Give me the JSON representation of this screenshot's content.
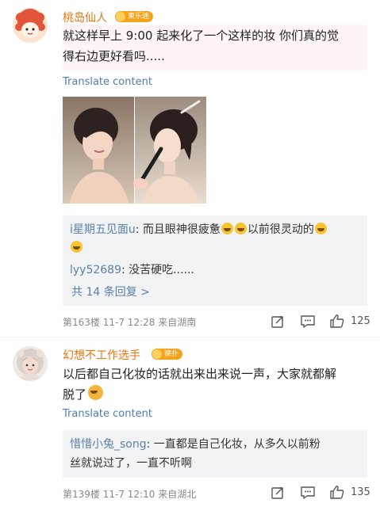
{
  "comment1": {
    "username": "桃岛仙人",
    "badge": "柬乐迷",
    "text_lines": [
      "就这样早上 9:00 起来化了一个这样的妆 你们真的觉",
      "得右边更好看吗....."
    ],
    "translate": "Translate content",
    "replies": [
      {
        "name": "i星期五见面u",
        "sep": ": ",
        "text": "而且眼神很疲惫",
        "text2": "以前很灵动的"
      },
      {
        "name": "lyy52689",
        "sep": ": ",
        "text": "没苦硬吃......"
      }
    ],
    "more_replies": "共 14 条回复 >",
    "floor": "第163楼",
    "time": "11-7 12:28",
    "location": "来自湖南",
    "likes": "125"
  },
  "comment2": {
    "username": "幻想不工作选手",
    "badge": "德扑",
    "text_lines": [
      "以后都自己化妆的话就出来出来说一声，大家就都解",
      "脱了"
    ],
    "translate": "Translate content",
    "replies": [
      {
        "name": "惜惜小兔_song",
        "sep": ": ",
        "text": "一直都是自己化妆，从多久以前粉",
        "text2": "丝就说过了，一直不听啊"
      }
    ],
    "floor": "第139楼",
    "time": "11-7 12:10",
    "location": "来自湖北",
    "likes": "135"
  },
  "colors": {
    "username": "#e8740c",
    "link": "#5b7fa8",
    "translate": "#4f7cac",
    "bubble": "#fff5f6",
    "reply_bg": "#f2f3f5"
  },
  "icons": [
    "share-icon",
    "comment-icon",
    "like-icon"
  ]
}
